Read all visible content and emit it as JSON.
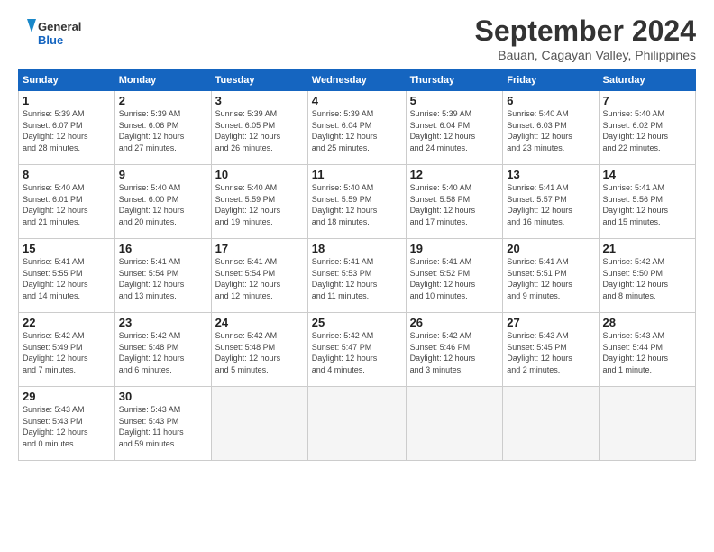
{
  "logo": {
    "line1": "General",
    "line2": "Blue"
  },
  "title": "September 2024",
  "location": "Bauan, Cagayan Valley, Philippines",
  "weekdays": [
    "Sunday",
    "Monday",
    "Tuesday",
    "Wednesday",
    "Thursday",
    "Friday",
    "Saturday"
  ],
  "weeks": [
    [
      {
        "day": "1",
        "info": "Sunrise: 5:39 AM\nSunset: 6:07 PM\nDaylight: 12 hours\nand 28 minutes."
      },
      {
        "day": "2",
        "info": "Sunrise: 5:39 AM\nSunset: 6:06 PM\nDaylight: 12 hours\nand 27 minutes."
      },
      {
        "day": "3",
        "info": "Sunrise: 5:39 AM\nSunset: 6:05 PM\nDaylight: 12 hours\nand 26 minutes."
      },
      {
        "day": "4",
        "info": "Sunrise: 5:39 AM\nSunset: 6:04 PM\nDaylight: 12 hours\nand 25 minutes."
      },
      {
        "day": "5",
        "info": "Sunrise: 5:39 AM\nSunset: 6:04 PM\nDaylight: 12 hours\nand 24 minutes."
      },
      {
        "day": "6",
        "info": "Sunrise: 5:40 AM\nSunset: 6:03 PM\nDaylight: 12 hours\nand 23 minutes."
      },
      {
        "day": "7",
        "info": "Sunrise: 5:40 AM\nSunset: 6:02 PM\nDaylight: 12 hours\nand 22 minutes."
      }
    ],
    [
      {
        "day": "8",
        "info": "Sunrise: 5:40 AM\nSunset: 6:01 PM\nDaylight: 12 hours\nand 21 minutes."
      },
      {
        "day": "9",
        "info": "Sunrise: 5:40 AM\nSunset: 6:00 PM\nDaylight: 12 hours\nand 20 minutes."
      },
      {
        "day": "10",
        "info": "Sunrise: 5:40 AM\nSunset: 5:59 PM\nDaylight: 12 hours\nand 19 minutes."
      },
      {
        "day": "11",
        "info": "Sunrise: 5:40 AM\nSunset: 5:59 PM\nDaylight: 12 hours\nand 18 minutes."
      },
      {
        "day": "12",
        "info": "Sunrise: 5:40 AM\nSunset: 5:58 PM\nDaylight: 12 hours\nand 17 minutes."
      },
      {
        "day": "13",
        "info": "Sunrise: 5:41 AM\nSunset: 5:57 PM\nDaylight: 12 hours\nand 16 minutes."
      },
      {
        "day": "14",
        "info": "Sunrise: 5:41 AM\nSunset: 5:56 PM\nDaylight: 12 hours\nand 15 minutes."
      }
    ],
    [
      {
        "day": "15",
        "info": "Sunrise: 5:41 AM\nSunset: 5:55 PM\nDaylight: 12 hours\nand 14 minutes."
      },
      {
        "day": "16",
        "info": "Sunrise: 5:41 AM\nSunset: 5:54 PM\nDaylight: 12 hours\nand 13 minutes."
      },
      {
        "day": "17",
        "info": "Sunrise: 5:41 AM\nSunset: 5:54 PM\nDaylight: 12 hours\nand 12 minutes."
      },
      {
        "day": "18",
        "info": "Sunrise: 5:41 AM\nSunset: 5:53 PM\nDaylight: 12 hours\nand 11 minutes."
      },
      {
        "day": "19",
        "info": "Sunrise: 5:41 AM\nSunset: 5:52 PM\nDaylight: 12 hours\nand 10 minutes."
      },
      {
        "day": "20",
        "info": "Sunrise: 5:41 AM\nSunset: 5:51 PM\nDaylight: 12 hours\nand 9 minutes."
      },
      {
        "day": "21",
        "info": "Sunrise: 5:42 AM\nSunset: 5:50 PM\nDaylight: 12 hours\nand 8 minutes."
      }
    ],
    [
      {
        "day": "22",
        "info": "Sunrise: 5:42 AM\nSunset: 5:49 PM\nDaylight: 12 hours\nand 7 minutes."
      },
      {
        "day": "23",
        "info": "Sunrise: 5:42 AM\nSunset: 5:48 PM\nDaylight: 12 hours\nand 6 minutes."
      },
      {
        "day": "24",
        "info": "Sunrise: 5:42 AM\nSunset: 5:48 PM\nDaylight: 12 hours\nand 5 minutes."
      },
      {
        "day": "25",
        "info": "Sunrise: 5:42 AM\nSunset: 5:47 PM\nDaylight: 12 hours\nand 4 minutes."
      },
      {
        "day": "26",
        "info": "Sunrise: 5:42 AM\nSunset: 5:46 PM\nDaylight: 12 hours\nand 3 minutes."
      },
      {
        "day": "27",
        "info": "Sunrise: 5:43 AM\nSunset: 5:45 PM\nDaylight: 12 hours\nand 2 minutes."
      },
      {
        "day": "28",
        "info": "Sunrise: 5:43 AM\nSunset: 5:44 PM\nDaylight: 12 hours\nand 1 minute."
      }
    ],
    [
      {
        "day": "29",
        "info": "Sunrise: 5:43 AM\nSunset: 5:43 PM\nDaylight: 12 hours\nand 0 minutes."
      },
      {
        "day": "30",
        "info": "Sunrise: 5:43 AM\nSunset: 5:43 PM\nDaylight: 11 hours\nand 59 minutes."
      },
      null,
      null,
      null,
      null,
      null
    ]
  ]
}
